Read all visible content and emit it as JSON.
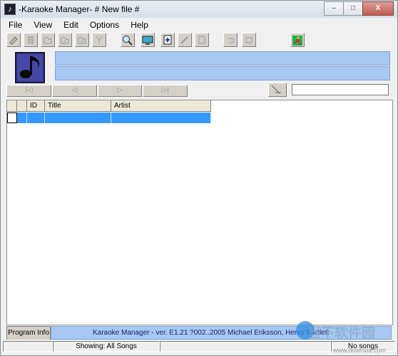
{
  "window": {
    "title": "-Karaoke Manager- # New file #",
    "minimize_glyph": "–",
    "maximize_glyph": "□",
    "close_glyph": "X"
  },
  "menu": [
    "File",
    "View",
    "Edit",
    "Options",
    "Help"
  ],
  "grid": {
    "columns": [
      "",
      "ID",
      "Title",
      "Artist"
    ]
  },
  "bottom": {
    "tab_label": "Program Info",
    "info_text": "Karaoke Manager - ver. E1.21 ?002..2005 Michael Eriksson, Henry Bartlett"
  },
  "status": {
    "showing": "Showing: All Songs",
    "songs": "No songs"
  },
  "watermark": {
    "text": "当下软件园",
    "url": "www.downxia.com"
  },
  "colors": {
    "selection": "#3399ff",
    "info_blue": "#a6c8f2"
  }
}
